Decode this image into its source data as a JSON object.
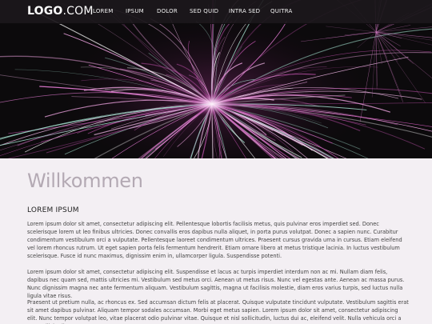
{
  "header": {
    "logo_bold": "LOGO",
    "logo_light": ".COM",
    "nav": [
      "LOREM",
      "IPSUM",
      "DOLOR",
      "SED QUID",
      "INTRA SED",
      "QUITRA"
    ]
  },
  "main": {
    "heading": "Willkommen",
    "section_title": "LOREM IPSUM",
    "paragraphs": [
      "Lorem ipsum dolor sit amet, consectetur adipiscing elit. Pellentesque lobortis facilisis metus, quis pulvinar eros imperdiet sed. Donec scelerisque lorem ut leo finibus ultricies. Donec convallis eros dapibus nulla aliquet, in porta purus volutpat. Donec a sapien nunc. Curabitur condimentum vestibulum orci a vulputate. Pellentesque laoreet condimentum ultrices. Praesent cursus gravida urna in cursus. Etiam eleifend vel lorem rhoncus rutrum. Ut eget sapien porta felis fermentum hendrerit. Etiam ornare libero at metus tristique lacinia. In luctus vestibulum scelerisque. Fusce id nunc maximus, dignissim enim in, ullamcorper ligula. Suspendisse potenti.",
      "Lorem ipsum dolor sit amet, consectetur adipiscing elit. Suspendisse et lacus ac turpis imperdiet interdum non ac mi. Nullam diam felis, dapibus nec quam sed, mattis ultricies mi. Vestibulum sed metus orci. Aenean ut metus risus. Nunc vel egestas ante. Aenean ac massa purus. Nunc dignissim magna nec ante fermentum aliquam. Vestibulum sagittis, magna ut facilisis molestie, diam eros varius turpis, sed luctus nulla ligula vitae risus.",
      "Praesent ut pretium nulla, ac rhoncus ex. Sed accumsan dictum felis at placerat. Quisque vulputate tincidunt vulputate. Vestibulum sagittis erat sit amet dapibus pulvinar. Aliquam tempor sodales accumsan. Morbi eget metus sapien. Lorem ipsum dolor sit amet, consectetur adipiscing elit. Nunc tempor volutpat leo, vitae placerat odio pulvinar vitae. Quisque et nisl sollicitudin, luctus dui ac, eleifend velit. Nulla vehicula orci a erat sollicitudin consectetur."
    ]
  },
  "colors": {
    "navbar": "#1c181c",
    "accent_firework": "#d96fc8",
    "background": "#f3eff3",
    "heading": "#b3a9b3"
  }
}
